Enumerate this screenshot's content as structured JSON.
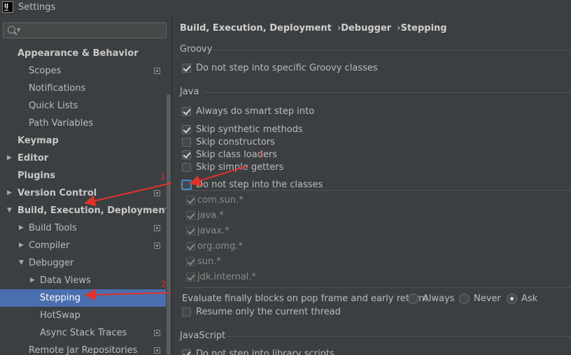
{
  "window": {
    "title": "Settings",
    "logo_text": "IJ"
  },
  "sidebar": {
    "search_placeholder": "",
    "items": [
      {
        "label": "Appearance & Behavior",
        "level": 0,
        "bold": true,
        "arrow": "",
        "copy": false
      },
      {
        "label": "Scopes",
        "level": 1,
        "bold": false,
        "arrow": "",
        "copy": true
      },
      {
        "label": "Notifications",
        "level": 1,
        "bold": false,
        "arrow": "",
        "copy": false
      },
      {
        "label": "Quick Lists",
        "level": 1,
        "bold": false,
        "arrow": "",
        "copy": false
      },
      {
        "label": "Path Variables",
        "level": 1,
        "bold": false,
        "arrow": "",
        "copy": false
      },
      {
        "label": "Keymap",
        "level": 0,
        "bold": true,
        "arrow": "",
        "copy": false
      },
      {
        "label": "Editor",
        "level": 0,
        "bold": true,
        "arrow": "▶",
        "copy": false
      },
      {
        "label": "Plugins",
        "level": 0,
        "bold": true,
        "arrow": "",
        "copy": false
      },
      {
        "label": "Version Control",
        "level": 0,
        "bold": true,
        "arrow": "▶",
        "copy": true
      },
      {
        "label": "Build, Execution, Deployment",
        "level": 0,
        "bold": true,
        "arrow": "▼",
        "copy": false
      },
      {
        "label": "Build Tools",
        "level": 1,
        "bold": false,
        "arrow": "▶",
        "copy": true
      },
      {
        "label": "Compiler",
        "level": 1,
        "bold": false,
        "arrow": "▶",
        "copy": true
      },
      {
        "label": "Debugger",
        "level": 1,
        "bold": false,
        "arrow": "▼",
        "copy": false
      },
      {
        "label": "Data Views",
        "level": 2,
        "bold": false,
        "arrow": "▶",
        "copy": false
      },
      {
        "label": "Stepping",
        "level": 2,
        "bold": false,
        "arrow": "",
        "copy": false,
        "selected": true
      },
      {
        "label": "HotSwap",
        "level": 2,
        "bold": false,
        "arrow": "",
        "copy": false
      },
      {
        "label": "Async Stack Traces",
        "level": 2,
        "bold": false,
        "arrow": "",
        "copy": true
      },
      {
        "label": "Remote Jar Repositories",
        "level": 1,
        "bold": false,
        "arrow": "",
        "copy": true
      }
    ]
  },
  "breadcrumb": [
    "Build, Execution, Deployment",
    "Debugger",
    "Stepping"
  ],
  "groovy": {
    "title": "Groovy",
    "options": [
      {
        "label": "Do not step into specific Groovy classes",
        "checked": true
      }
    ]
  },
  "java": {
    "title": "Java",
    "options": [
      {
        "label": "Always do smart step into",
        "checked": true
      },
      {
        "label": "Skip synthetic methods",
        "checked": true
      },
      {
        "label": "Skip constructors",
        "checked": false
      },
      {
        "label": "Skip class loaders",
        "checked": true
      },
      {
        "label": "Skip simple getters",
        "checked": false
      },
      {
        "label": "Do not step into the classes",
        "checked": false,
        "focused": true
      }
    ],
    "classes": [
      {
        "label": "com.sun.*",
        "checked": true
      },
      {
        "label": "java.*",
        "checked": true
      },
      {
        "label": "javax.*",
        "checked": true
      },
      {
        "label": "org.omg.*",
        "checked": true
      },
      {
        "label": "sun.*",
        "checked": true
      },
      {
        "label": "jdk.internal.*",
        "checked": true
      },
      {
        "label": "",
        "checked": true
      }
    ]
  },
  "evaluate": {
    "label": "Evaluate finally blocks on pop frame and early return:",
    "options": [
      {
        "label": "Always",
        "checked": false
      },
      {
        "label": "Never",
        "checked": false
      },
      {
        "label": "Ask",
        "checked": true
      }
    ]
  },
  "resume": {
    "label": "Resume only the current thread",
    "checked": false
  },
  "javascript": {
    "title": "JavaScript",
    "options": [
      {
        "label": "Do not step into library scripts",
        "checked": true
      }
    ]
  },
  "annotations": {
    "arrow_1_number": "1",
    "arrow_2_number": "2",
    "color": "#e0322a"
  }
}
